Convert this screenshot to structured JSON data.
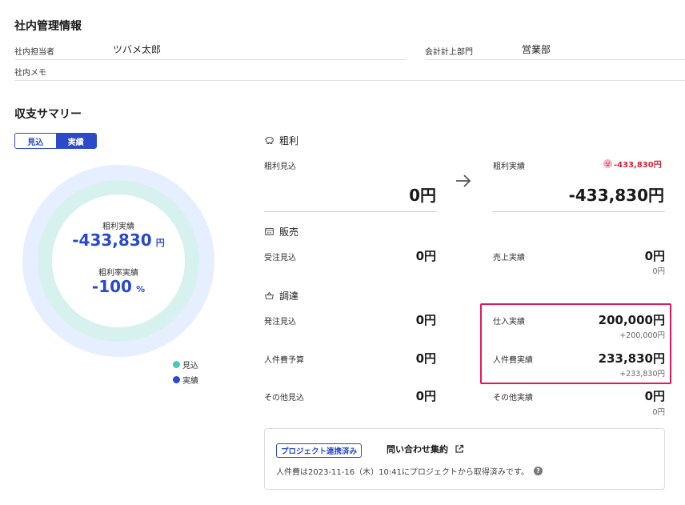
{
  "internal": {
    "title": "社内管理情報",
    "person_label": "社内担当者",
    "person_value": "ツバメ太郎",
    "dept_label": "会計計上部門",
    "dept_value": "営業部",
    "memo_label": "社内メモ"
  },
  "summary": {
    "title": "収支サマリー",
    "toggle": {
      "forecast": "見込",
      "actual": "実績",
      "selected": "実績"
    },
    "donut": {
      "profit_label": "粗利実績",
      "profit_value": "-433,830",
      "profit_unit": "円",
      "rate_label": "粗利率実績",
      "rate_value": "-100",
      "rate_unit": "%",
      "outer_color": "#e6efff",
      "inner_color": "#d7f2ee"
    },
    "legend": [
      {
        "label": "見込",
        "color": "#4fc4b8"
      },
      {
        "label": "実績",
        "color": "#2b49c8"
      }
    ]
  },
  "gross": {
    "heading": "粗利",
    "icon": "piggy-bank-icon",
    "forecast_label": "粗利見込",
    "forecast_value": "0円",
    "actual_label": "粗利実績",
    "actual_value": "-433,830円",
    "badge_value": "-433,830円",
    "arrow_icon": "arrow-right-icon"
  },
  "sales": {
    "heading": "販売",
    "icon": "register-icon",
    "order_forecast_label": "受注見込",
    "order_forecast_value": "0円",
    "sales_actual_label": "売上実績",
    "sales_actual_value": "0円",
    "sales_actual_sub": "0円"
  },
  "procurement": {
    "heading": "調達",
    "icon": "basket-icon",
    "order_label": "発注見込",
    "order_value": "0円",
    "purchase_label": "仕入実績",
    "purchase_value": "200,000円",
    "purchase_sub": "+200,000円",
    "labor_budget_label": "人件費予算",
    "labor_budget_value": "0円",
    "labor_actual_label": "人件費実績",
    "labor_actual_value": "233,830円",
    "labor_actual_sub": "+233,830円",
    "other_forecast_label": "その他見込",
    "other_forecast_value": "0円",
    "other_actual_label": "その他実績",
    "other_actual_value": "0円",
    "other_actual_sub": "0円"
  },
  "info": {
    "tag": "プロジェクト連携済み",
    "link": "問い合わせ集約",
    "note": "人件費は2023-11-16（木）10:41にプロジェクトから取得済みです。"
  }
}
